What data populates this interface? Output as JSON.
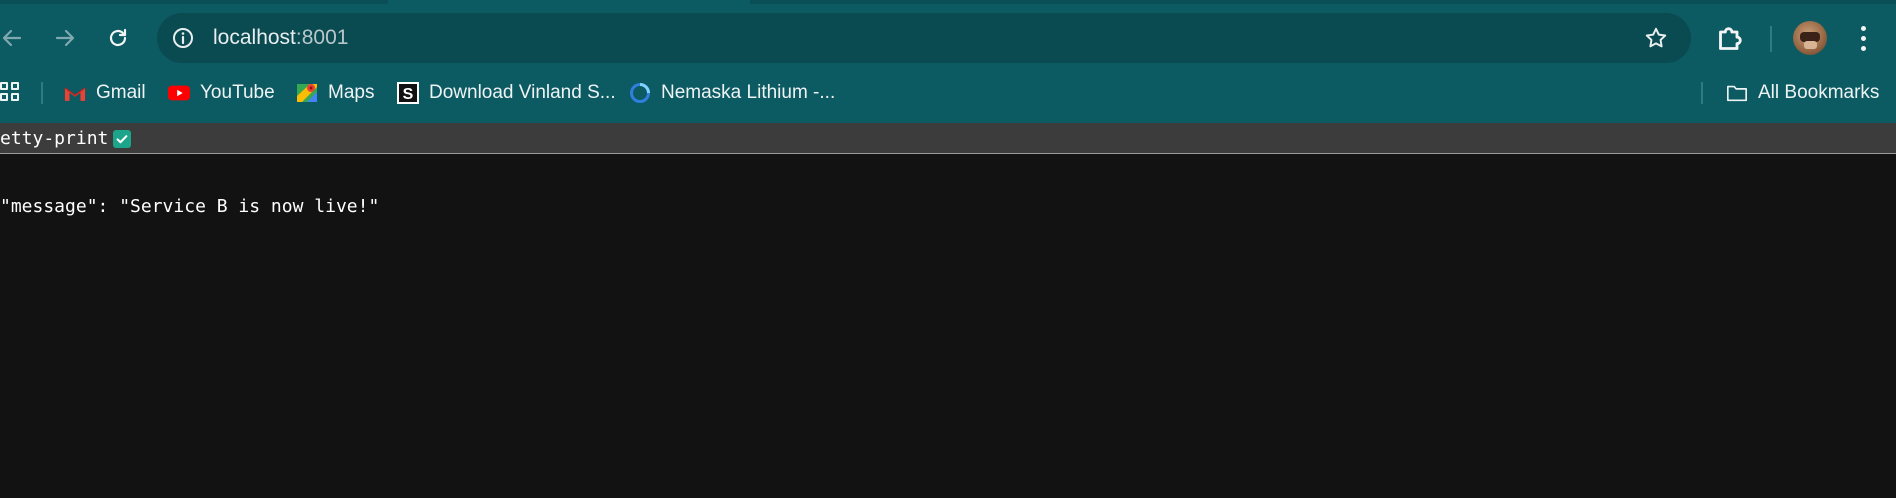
{
  "browser": {
    "url_host": "localhost",
    "url_port": ":8001",
    "colors": {
      "frame": "#0c5a62",
      "omnibox": "#0a4a51",
      "page_bg": "#121212",
      "viewer_bar": "#3c3c3c",
      "checkbox": "#1ca58a"
    }
  },
  "toolbar": {
    "icons": [
      "back-arrow-icon",
      "forward-arrow-icon",
      "reload-icon",
      "site-info-icon",
      "bookmark-star-icon",
      "extensions-puzzle-icon",
      "profile-avatar",
      "more-vert-icon"
    ]
  },
  "bookmarks": {
    "items": [
      {
        "label": "Gmail",
        "icon": "gmail-icon"
      },
      {
        "label": "YouTube",
        "icon": "youtube-icon"
      },
      {
        "label": "Maps",
        "icon": "maps-icon"
      },
      {
        "label": "Download Vinland S...",
        "icon": "s-logo-icon"
      },
      {
        "label": "Nemaska Lithium -...",
        "icon": "circle-logo-icon"
      }
    ],
    "all_label": "All Bookmarks"
  },
  "viewer": {
    "pretty_print_label": "etty-print",
    "pretty_print_checked": true
  },
  "content": {
    "json_line": "\"message\": \"Service B is now live!\""
  }
}
